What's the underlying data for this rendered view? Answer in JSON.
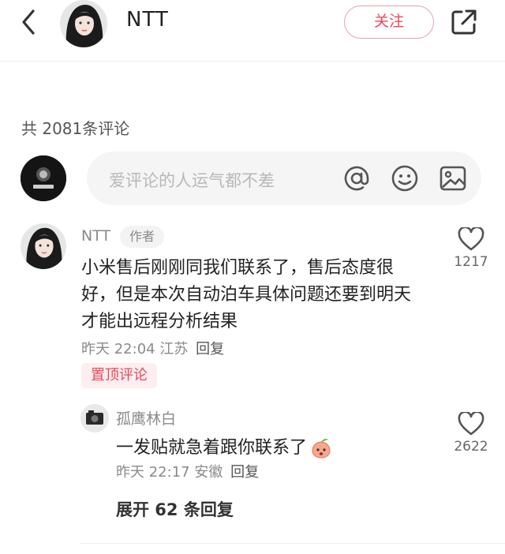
{
  "header": {
    "user_name": "NTT",
    "follow_label": "关注"
  },
  "comments_section": {
    "count_label": "共 2081条评论",
    "input_placeholder": "爱评论的人运气都不差"
  },
  "pinned_comment": {
    "author": "NTT",
    "author_tag": "作者",
    "text": "小米售后刚刚同我们联系了，售后态度很好，但是本次自动泊车具体问题还要到明天才能出远程分析结果",
    "time": "昨天 22:04",
    "location": "江苏",
    "reply_label": "回复",
    "pin_label": "置顶评论",
    "likes": "1217"
  },
  "reply": {
    "author": "孤鹰林白",
    "text": "一发贴就急着跟你联系了",
    "emoji_icon": "peach-face-emoji",
    "time": "昨天 22:17",
    "location": "安徽",
    "reply_label": "回复",
    "likes": "2622"
  },
  "expand_label": "展开 62 条回复",
  "colors": {
    "accent": "#e8495b",
    "muted": "#8a8a8a"
  }
}
